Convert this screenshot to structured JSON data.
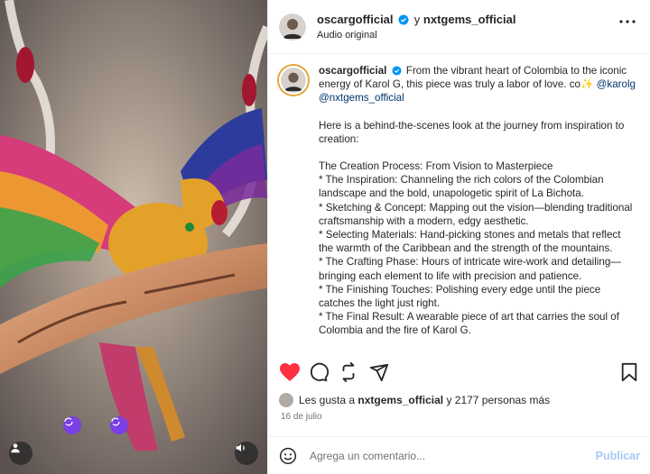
{
  "header": {
    "user": "oscargofficial",
    "conjunction": "y",
    "coauthor": "nxtgems_official",
    "audio": "Audio original"
  },
  "caption": {
    "user": "oscargofficial",
    "intro": "From the vibrant heart of Colombia to the iconic energy of Karol G, this piece was truly a labor of love. co✨",
    "mention1": "@karolg",
    "mention2": "@nxtgems_official",
    "lines": [
      "Here is a behind-the-scenes look at the journey from inspiration to creation:",
      "",
      "The Creation Process: From Vision to Masterpiece",
      "* The Inspiration: Channeling the rich colors of the Colombian landscape and the bold, unapologetic spirit of La Bichota.",
      "* Sketching & Concept: Mapping out the vision—blending traditional craftsmanship with a modern, edgy aesthetic.",
      "* Selecting Materials: Hand-picking stones and metals that reflect the warmth of the Caribbean and the strength of the mountains.",
      "* The Crafting Phase: Hours of intricate wire-work and detailing—bringing each element to life with precision and patience.",
      "* The Finishing Touches: Polishing every edge until the piece catches the light just right.",
      "* The Final Result: A wearable piece of art that carries the soul of Colombia and the fire of Karol G."
    ]
  },
  "likes": {
    "prefix": "Les gusta a",
    "user": "nxtgems_official",
    "suffix": "y 2177 personas más"
  },
  "date": "16 de julio",
  "comment": {
    "placeholder": "Agrega un comentario...",
    "publish": "Publicar"
  },
  "colors": {
    "like_red": "#ff3040",
    "link": "#00376b",
    "publish_disabled": "#a5c9f5",
    "tag_purple": "#7b3fe4"
  },
  "icons": [
    "heart-icon",
    "comment-icon",
    "share-icon",
    "send-icon",
    "bookmark-icon",
    "more-icon",
    "verified-icon",
    "emoji-icon",
    "user-tag-icon",
    "speaker-icon"
  ]
}
